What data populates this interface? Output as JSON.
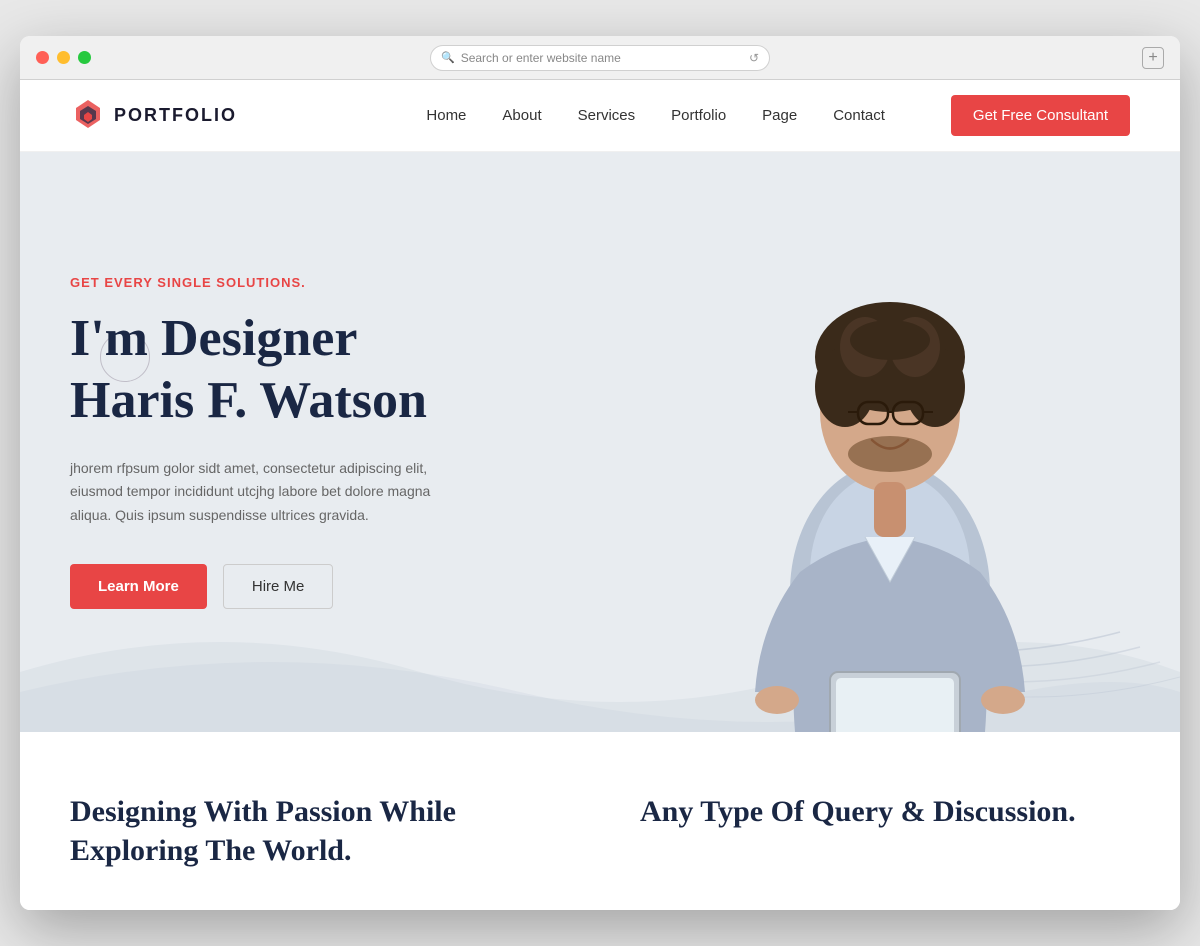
{
  "browser": {
    "address_placeholder": "Search or enter website name"
  },
  "navbar": {
    "logo_text": "PORTFOLIO",
    "nav_items": [
      {
        "label": "Home",
        "id": "home"
      },
      {
        "label": "About",
        "id": "about"
      },
      {
        "label": "Services",
        "id": "services"
      },
      {
        "label": "Portfolio",
        "id": "portfolio"
      },
      {
        "label": "Page",
        "id": "page"
      },
      {
        "label": "Contact",
        "id": "contact"
      }
    ],
    "cta_label": "Get Free Consultant"
  },
  "hero": {
    "tagline": "GET EVERY SINGLE SOLUTIONS.",
    "title_line1": "I'm Designer",
    "title_line2": "Haris F. Watson",
    "description": "jhorem rfpsum golor sidt amet, consectetur adipiscing elit, eiusmod tempor incididunt utcjhg labore bet dolore magna aliqua. Quis ipsum suspendisse ultrices gravida.",
    "btn_primary": "Learn More",
    "btn_secondary": "Hire Me"
  },
  "bottom": {
    "left_title": "Designing With Passion While Exploring The World.",
    "right_title": "Any Type Of Query & Discussion."
  }
}
